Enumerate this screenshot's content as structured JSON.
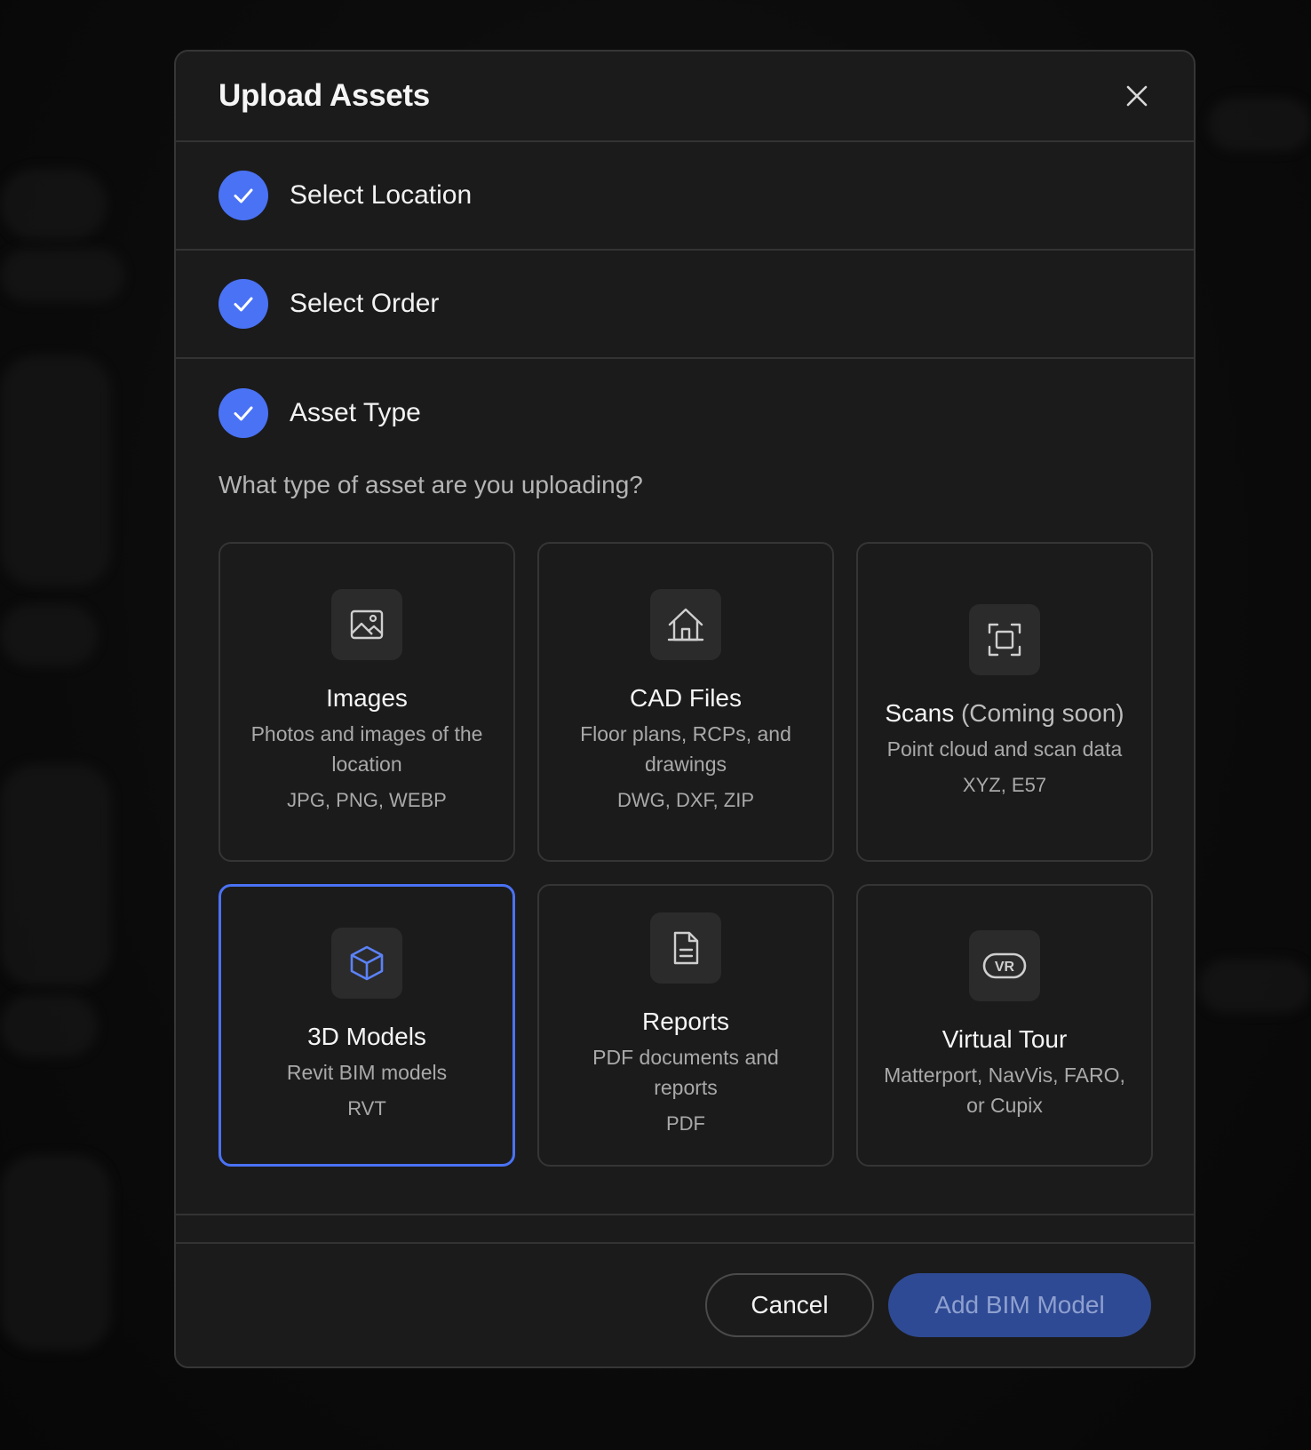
{
  "modal": {
    "title": "Upload Assets"
  },
  "steps": [
    {
      "label": "Select Location",
      "status": "complete"
    },
    {
      "label": "Select Order",
      "status": "complete"
    },
    {
      "label": "Asset Type",
      "status": "complete"
    }
  ],
  "asset_type": {
    "question": "What type of asset are you uploading?",
    "cards": [
      {
        "icon": "image-icon",
        "title": "Images",
        "title_suffix": "",
        "description": "Photos and images of the location",
        "formats": "JPG, PNG, WEBP",
        "selected": false
      },
      {
        "icon": "house-icon",
        "title": "CAD Files",
        "title_suffix": "",
        "description": "Floor plans, RCPs, and drawings",
        "formats": "DWG, DXF, ZIP",
        "selected": false
      },
      {
        "icon": "scan-icon",
        "title": "Scans",
        "title_suffix": "(Coming soon)",
        "description": "Point cloud and scan data",
        "formats": "XYZ, E57",
        "selected": false
      },
      {
        "icon": "cube-icon",
        "title": "3D Models",
        "title_suffix": "",
        "description": "Revit BIM models",
        "formats": "RVT",
        "selected": true
      },
      {
        "icon": "document-icon",
        "title": "Reports",
        "title_suffix": "",
        "description": "PDF documents and reports",
        "formats": "PDF",
        "selected": false
      },
      {
        "icon": "vr-icon",
        "title": "Virtual Tour",
        "title_suffix": "",
        "description": "Matterport, NavVis, FARO, or Cupix",
        "formats": "",
        "selected": false
      }
    ]
  },
  "footer": {
    "cancel_label": "Cancel",
    "primary_label": "Add BIM Model"
  },
  "colors": {
    "accent": "#4a72f5",
    "primary_button": "#2f4a94",
    "background": "#1b1b1b"
  }
}
